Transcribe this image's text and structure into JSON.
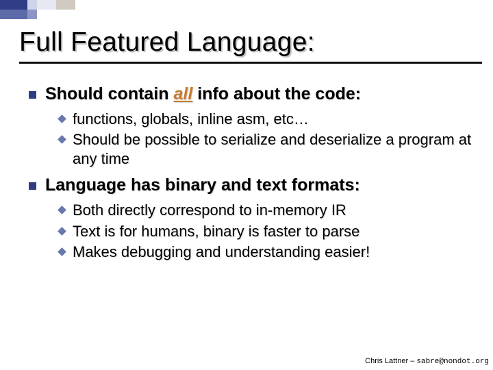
{
  "title": "Full Featured Language:",
  "sections": [
    {
      "heading_pre": "Should contain ",
      "heading_em": "all",
      "heading_post": " info about the code:",
      "items": [
        "functions, globals, inline asm, etc…",
        "Should be possible to serialize and deserialize a program at any time"
      ]
    },
    {
      "heading_pre": "Language has binary and text formats:",
      "heading_em": "",
      "heading_post": "",
      "items": [
        "Both directly correspond to in-memory IR",
        "Text is for humans, binary is faster to parse",
        "Makes debugging and understanding easier!"
      ]
    }
  ],
  "footer": {
    "author": "Chris Lattner",
    "sep": " – ",
    "email": "sabre@nondot.org"
  }
}
